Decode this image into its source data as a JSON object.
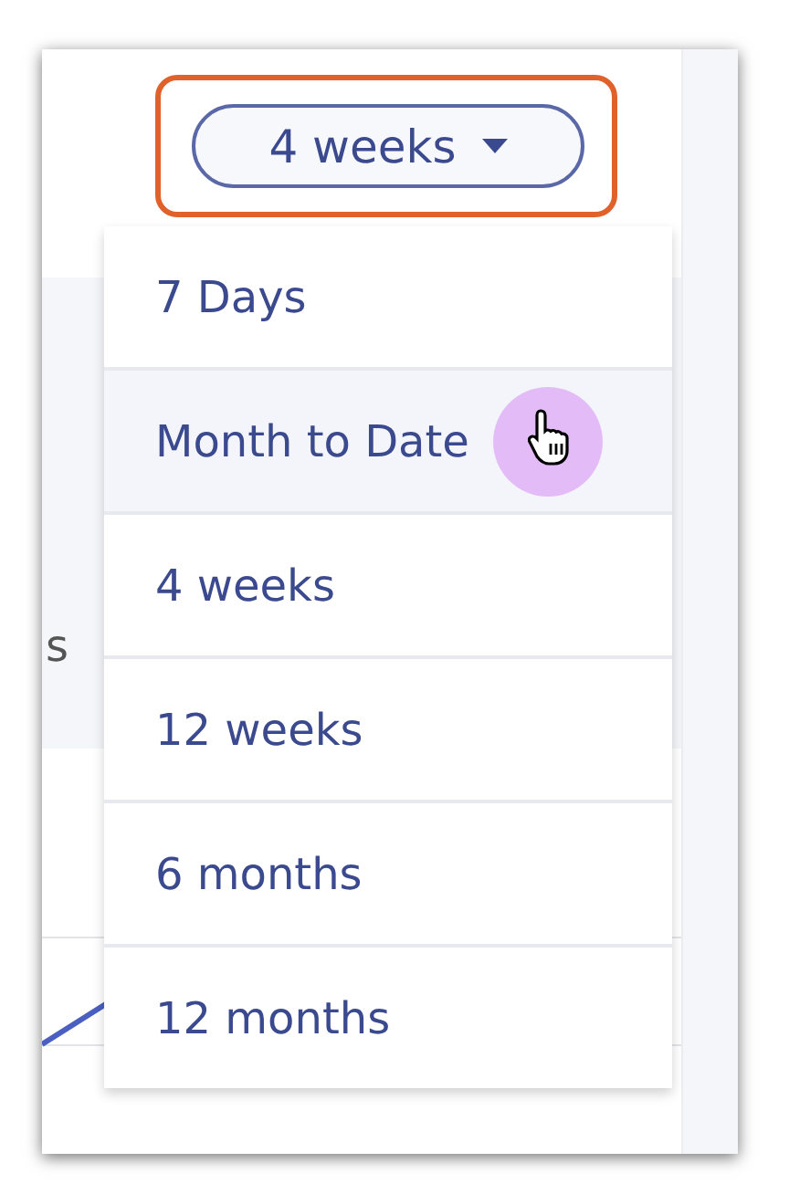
{
  "range_button": {
    "label": "4 weeks",
    "highlighted": true
  },
  "panel": {
    "text": "s"
  },
  "menu": {
    "items": [
      {
        "label": "7 Days",
        "hovered": false
      },
      {
        "label": "Month to Date",
        "hovered": true
      },
      {
        "label": "4 weeks",
        "hovered": false
      },
      {
        "label": "12 weeks",
        "hovered": false
      },
      {
        "label": "6 months",
        "hovered": false
      },
      {
        "label": "12 months",
        "hovered": false
      }
    ]
  }
}
